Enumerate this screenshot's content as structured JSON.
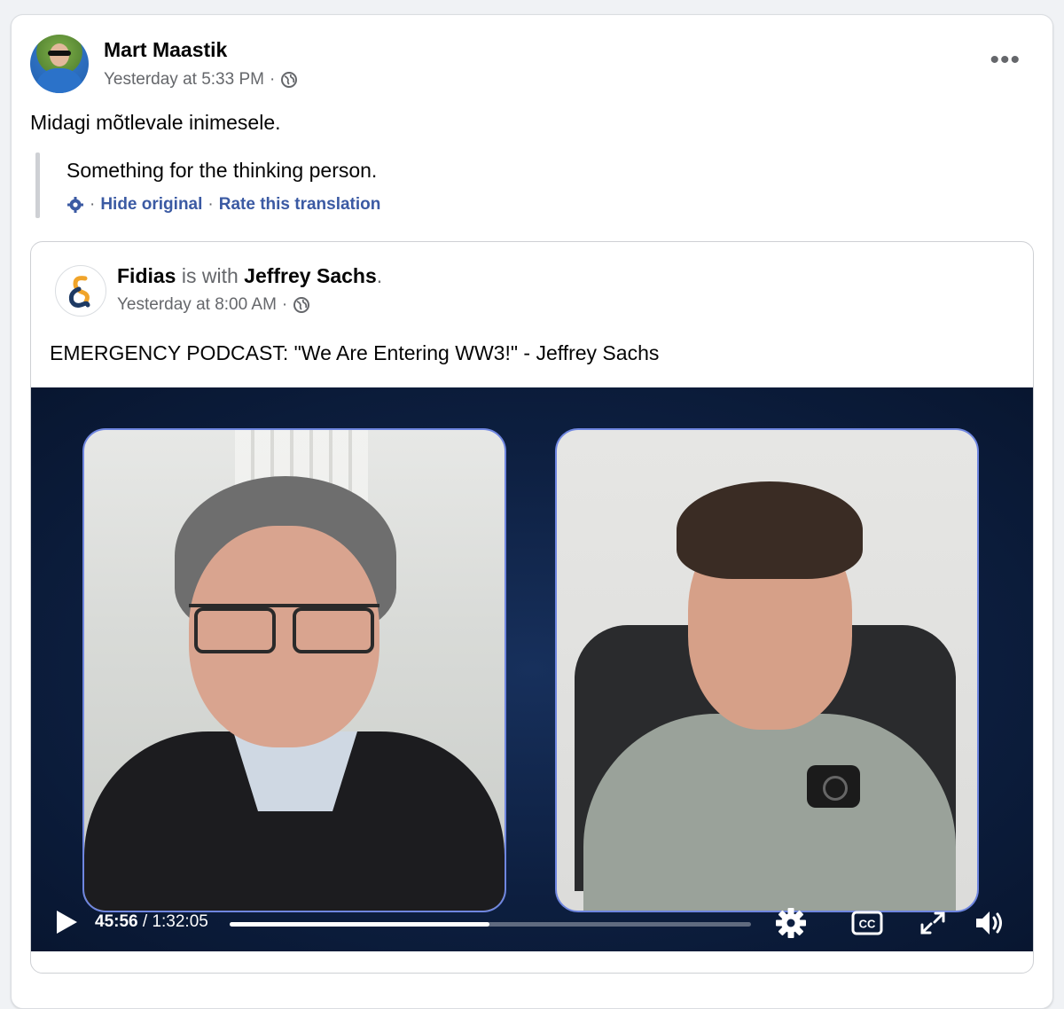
{
  "post": {
    "author": "Mart Maastik",
    "timestamp": "Yesterday at 5:33 PM",
    "separator": "·",
    "privacy_icon": "globe-icon",
    "more_icon": "more-options-icon",
    "more_label": "•••",
    "text": "Midagi mõtlevale inimesele.",
    "translation": {
      "text": "Something for the thinking person.",
      "settings_icon": "gear-icon",
      "hide_original": "Hide original",
      "rate": "Rate this translation",
      "separator": "·"
    }
  },
  "shared_post": {
    "page_name": "Fidias",
    "with_text": "is with",
    "tagged": "Jeffrey Sachs",
    "period": ".",
    "timestamp": "Yesterday at 8:00 AM",
    "separator": "·",
    "privacy_icon": "globe-icon",
    "title": "EMERGENCY PODCAST: \"We Are Entering WW3!\" - Jeffrey Sachs"
  },
  "video": {
    "current_time": "45:56",
    "time_separator": " / ",
    "duration": "1:32:05",
    "progress": 0.4975,
    "icons": [
      "play-icon",
      "settings-icon",
      "captions-icon",
      "fullscreen-icon",
      "volume-icon"
    ],
    "cc_label": "CC"
  },
  "colors": {
    "link": "#385898",
    "secondary_text": "#65676b",
    "video_bg": "#0d1f40",
    "frame_border": "#6f86e0"
  }
}
